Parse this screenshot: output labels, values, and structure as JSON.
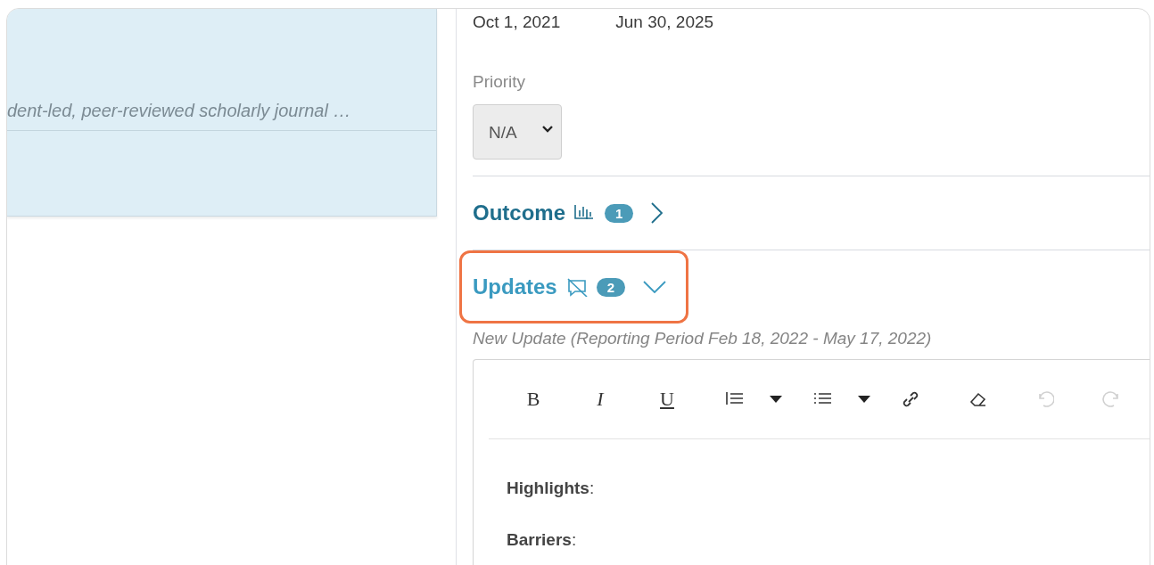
{
  "left_card": {
    "description": "dent-led, peer-reviewed scholarly journal …"
  },
  "detail": {
    "dates": [
      "Oct 1, 2021",
      "Jun 30, 2025"
    ],
    "priority": {
      "label": "Priority",
      "value": "N/A"
    },
    "sections": [
      {
        "title": "Outcome",
        "kind": "chart",
        "count": "1",
        "expanded": false,
        "highlighted": false
      },
      {
        "title": "Updates",
        "kind": "comment-off",
        "count": "2",
        "expanded": true,
        "highlighted": true
      }
    ],
    "update_caption": "New Update (Reporting Period Feb 18, 2022 - May 17, 2022)",
    "editor": {
      "toolbar": [
        {
          "kind": "bold",
          "label": "B",
          "disabled": false
        },
        {
          "kind": "italic",
          "label": "I",
          "disabled": false
        },
        {
          "kind": "underline",
          "label": "U",
          "disabled": false
        },
        {
          "kind": "ordered-list",
          "dropdown": true,
          "disabled": false
        },
        {
          "kind": "bullet-list",
          "dropdown": true,
          "disabled": false
        },
        {
          "kind": "link",
          "disabled": false
        },
        {
          "kind": "eraser",
          "disabled": false
        },
        {
          "kind": "undo",
          "disabled": true
        },
        {
          "kind": "redo",
          "disabled": true
        }
      ],
      "lines": [
        "**Highlights**:",
        "**Barriers**:"
      ]
    }
  }
}
